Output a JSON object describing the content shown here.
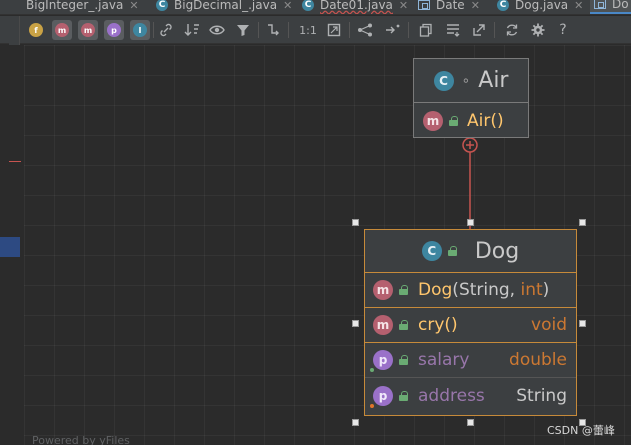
{
  "tabs": [
    {
      "label": "BigInteger_.java",
      "icon": "class-icon"
    },
    {
      "label": "BigDecimal_.java",
      "icon": "class-icon"
    },
    {
      "label": "Date01.java",
      "icon": "class-icon"
    },
    {
      "label": "Date",
      "icon": "uml-diagram-icon"
    },
    {
      "label": "Dog.java",
      "icon": "class-icon"
    },
    {
      "label": "Do",
      "icon": "uml-diagram-icon"
    }
  ],
  "toolbar": {
    "items": [
      "fields-filter-icon",
      "constructors-filter-icon",
      "methods-filter-icon",
      "properties-filter-icon",
      "inner-classes-filter-icon",
      "dependencies-icon",
      "sort-icon",
      "visibility-icon",
      "filter-icon",
      "edge-route-icon",
      "actual-size",
      "fit-content-icon",
      "layout-icon",
      "apply-layout-icon",
      "copy-icon",
      "export-icon",
      "export-to-file-icon",
      "refresh-icon",
      "settings-icon",
      "help-icon"
    ],
    "toggle_letters": {
      "f": "f",
      "c": "m",
      "m": "m",
      "p": "p",
      "i": "I"
    },
    "actual_size_label": "1:1",
    "help_label": "?"
  },
  "diagram": {
    "air": {
      "name": "Air",
      "class_letter": "C",
      "method_letter": "m",
      "method": "Air()",
      "marker": "∘"
    },
    "dog": {
      "name": "Dog",
      "class_letter": "C",
      "constructor": {
        "name": "Dog",
        "params": "String, ",
        "param2": "int",
        "letter": "m"
      },
      "method": {
        "name": "cry()",
        "type": "void",
        "letter": "m"
      },
      "fields": [
        {
          "name": "salary",
          "type": "double",
          "letter": "p"
        },
        {
          "name": "address",
          "type": "String",
          "letter": "p"
        }
      ]
    }
  },
  "colors": {
    "class": "#3e86a0",
    "method": "#b5606f",
    "property": "#9a71c9",
    "type": "#cc7832",
    "method_name": "#ffc66d",
    "field_name": "#9876aa",
    "relation": "#c75450"
  },
  "footer": {
    "powered_by": "Powered by yFiles",
    "watermark": "CSDN @蕾峰"
  }
}
